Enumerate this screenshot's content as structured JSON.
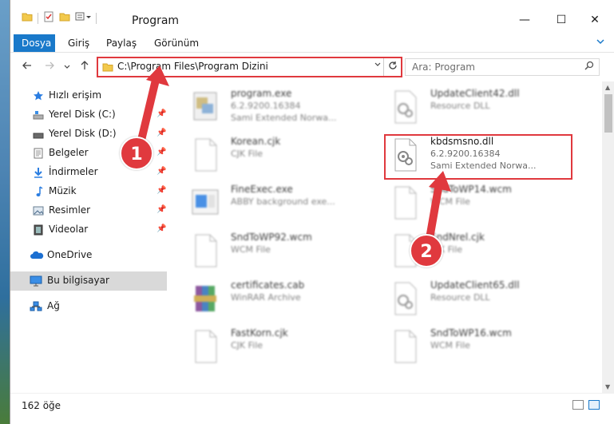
{
  "window": {
    "title": "Program",
    "controls": {
      "minimize": "—",
      "maximize": "☐",
      "close": "✕"
    }
  },
  "ribbon": {
    "tabs": [
      {
        "label": "Dosya",
        "active": true
      },
      {
        "label": "Giriş",
        "active": false
      },
      {
        "label": "Paylaş",
        "active": false
      },
      {
        "label": "Görünüm",
        "active": false
      }
    ]
  },
  "nav": {
    "address": "C:\\Program Files\\Program Dizini",
    "search_placeholder": "Ara: Program"
  },
  "sidebar": {
    "items": [
      {
        "label": "Hızlı erişim",
        "icon": "star-icon",
        "pinned": false
      },
      {
        "label": "Yerel Disk (C:)",
        "icon": "drive-icon",
        "pinned": true
      },
      {
        "label": "Yerel Disk (D:)",
        "icon": "drive-icon",
        "pinned": true
      },
      {
        "label": "Belgeler",
        "icon": "documents-icon",
        "pinned": true
      },
      {
        "label": "İndirmeler",
        "icon": "download-icon",
        "pinned": true
      },
      {
        "label": "Müzik",
        "icon": "music-icon",
        "pinned": true
      },
      {
        "label": "Resimler",
        "icon": "pictures-icon",
        "pinned": true
      },
      {
        "label": "Videolar",
        "icon": "videos-icon",
        "pinned": true
      },
      {
        "label": "OneDrive",
        "icon": "cloud-icon",
        "pinned": false
      },
      {
        "label": "Bu bilgisayar",
        "icon": "computer-icon",
        "pinned": false,
        "selected": true
      },
      {
        "label": "Ağ",
        "icon": "network-icon",
        "pinned": false
      }
    ]
  },
  "files": {
    "left": [
      {
        "name": "program.exe",
        "line2": "6.2.9200.16384",
        "line3": "Sami Extended Norwa..."
      },
      {
        "name": "Korean.cjk",
        "line2": "CJK File",
        "line3": ""
      },
      {
        "name": "FineExec.exe",
        "line2": "ABBY background exe...",
        "line3": ""
      },
      {
        "name": "SndToWP92.wcm",
        "line2": "WCM File",
        "line3": ""
      },
      {
        "name": "certificates.cab",
        "line2": "WinRAR Archive",
        "line3": ""
      },
      {
        "name": "FastKorn.cjk",
        "line2": "CJK File",
        "line3": ""
      }
    ],
    "right": [
      {
        "name": "UpdateClient42.dll",
        "line2": "Resource DLL",
        "line3": ""
      },
      {
        "name": "kbdsmsno.dll",
        "line2": "6.2.9200.16384",
        "line3": "Sami Extended Norwa..."
      },
      {
        "name": "SndToWP14.wcm",
        "line2": "WCM File",
        "line3": ""
      },
      {
        "name": "SndNrel.cjk",
        "line2": "CJK File",
        "line3": ""
      },
      {
        "name": "UpdateClient65.dll",
        "line2": "Resource DLL",
        "line3": ""
      },
      {
        "name": "SndToWP16.wcm",
        "line2": "WCM File",
        "line3": ""
      }
    ]
  },
  "status": {
    "item_count": "162 öğe"
  },
  "callouts": {
    "first": "1",
    "second": "2",
    "color": "#e0393e"
  },
  "colors": {
    "accent": "#1979ca",
    "highlight": "#e0393e"
  }
}
